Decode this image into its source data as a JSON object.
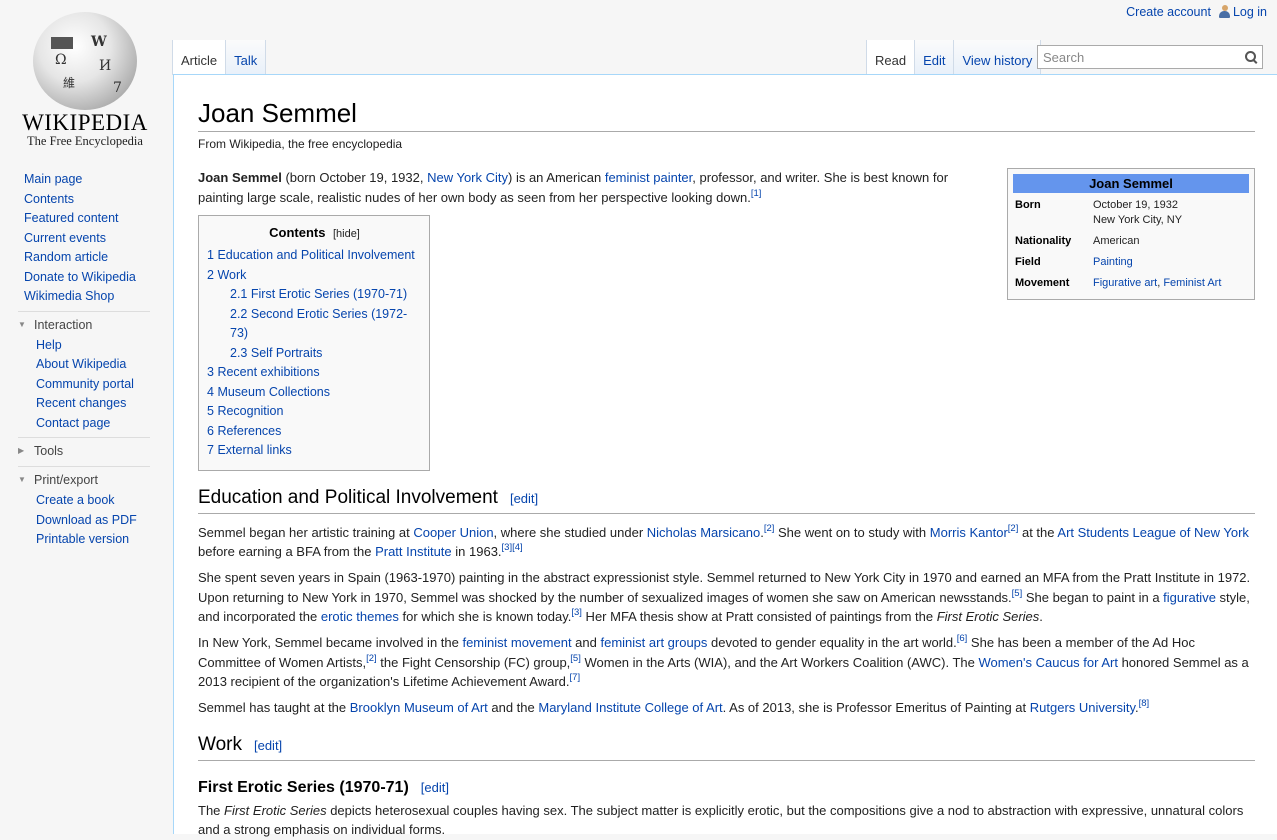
{
  "logo": {
    "wordmark": "Wikipedia",
    "tagline": "The Free Encyclopedia"
  },
  "personal": {
    "create_account": "Create account",
    "log_in": "Log in"
  },
  "tabs": {
    "left": [
      {
        "label": "Article",
        "selected": true
      },
      {
        "label": "Talk",
        "selected": false
      }
    ],
    "right": [
      {
        "label": "Read",
        "selected": true
      },
      {
        "label": "Edit",
        "selected": false
      },
      {
        "label": "View history",
        "selected": false
      }
    ]
  },
  "search": {
    "placeholder": "Search",
    "value": ""
  },
  "sidebar": {
    "navigation": [
      "Main page",
      "Contents",
      "Featured content",
      "Current events",
      "Random article",
      "Donate to Wikipedia",
      "Wikimedia Shop"
    ],
    "interaction": {
      "title": "Interaction",
      "items": [
        "Help",
        "About Wikipedia",
        "Community portal",
        "Recent changes",
        "Contact page"
      ]
    },
    "tools": {
      "title": "Tools"
    },
    "print": {
      "title": "Print/export",
      "items": [
        "Create a book",
        "Download as PDF",
        "Printable version"
      ]
    }
  },
  "article": {
    "title": "Joan Semmel",
    "subtitle": "From Wikipedia, the free encyclopedia",
    "intro": {
      "name": "Joan Semmel",
      "t1": " (born October 19, 1932, ",
      "l1": "New York City",
      "t2": ") is an American ",
      "l2": "feminist painter",
      "t3": ", professor, and writer. She is best known for painting large scale, realistic nudes of her own body as seen from her perspective looking down.",
      "ref1": "[1]"
    },
    "infobox": {
      "title": "Joan Semmel",
      "born_label": "Born",
      "born_date": "October 19, 1932",
      "born_place": "New York City, NY",
      "nationality_label": "Nationality",
      "nationality": "American",
      "field_label": "Field",
      "field": "Painting",
      "movement_label": "Movement",
      "movement_1": "Figurative art",
      "movement_sep": ", ",
      "movement_2": "Feminist Art"
    },
    "toc": {
      "title": "Contents",
      "toggle": "[hide]",
      "items": [
        {
          "num": "1",
          "label": "Education and Political Involvement"
        },
        {
          "num": "2",
          "label": "Work"
        },
        {
          "num": "2.1",
          "label": "First Erotic Series (1970-71)"
        },
        {
          "num": "2.2",
          "label": "Second Erotic Series (1972-73)"
        },
        {
          "num": "2.3",
          "label": "Self Portraits"
        },
        {
          "num": "3",
          "label": "Recent exhibitions"
        },
        {
          "num": "4",
          "label": "Museum Collections"
        },
        {
          "num": "5",
          "label": "Recognition"
        },
        {
          "num": "6",
          "label": "References"
        },
        {
          "num": "7",
          "label": "External links"
        }
      ]
    },
    "edit_label": "[edit]",
    "education": {
      "heading": "Education and Political Involvement",
      "p1": {
        "t1": "Semmel began her artistic training at ",
        "l1": "Cooper Union",
        "t2": ", where she studied under ",
        "l2": "Nicholas Marsicano",
        "t3": ".",
        "r1": "[2]",
        "t4": " She went on to study with ",
        "l3": "Morris Kantor",
        "r2": "[2]",
        "t5": " at the ",
        "l4": "Art Students League of New York",
        "t6": " before earning a BFA from the ",
        "l5": "Pratt Institute",
        "t7": " in 1963.",
        "r3": "[3][4]"
      },
      "p2": {
        "t1": "She spent seven years in Spain (1963-1970) painting in the abstract expressionist style. Semmel returned to New York City in 1970 and earned an MFA from the Pratt Institute in 1972. Upon returning to New York in 1970, Semmel was shocked by the number of sexualized images of women she saw on American newsstands.",
        "r1": "[5]",
        "t2": " She began to paint in a ",
        "l1": "figurative",
        "t3": " style, and incorporated the ",
        "l2": "erotic themes",
        "t4": " for which she is known today.",
        "r2": "[3]",
        "t5": " Her MFA thesis show at Pratt consisted of paintings from the ",
        "i1": "First Erotic Series",
        "t6": "."
      },
      "p3": {
        "t1": "In New York, Semmel became involved in the ",
        "l1": "feminist movement",
        "t2": " and ",
        "l2": "feminist art groups",
        "t3": " devoted to gender equality in the art world.",
        "r1": "[6]",
        "t4": " She has been a member of the Ad Hoc Committee of Women Artists,",
        "r2": "[2]",
        "t5": " the Fight Censorship (FC) group,",
        "r3": "[5]",
        "t6": " Women in the Arts (WIA), and the Art Workers Coalition (AWC). The ",
        "l3": "Women's Caucus for Art",
        "t7": " honored Semmel as a 2013 recipient of the organization's Lifetime Achievement Award.",
        "r4": "[7]"
      },
      "p4": {
        "t1": "Semmel has taught at the ",
        "l1": "Brooklyn Museum of Art",
        "t2": " and the ",
        "l2": "Maryland Institute College of Art",
        "t3": ". As of 2013, she is Professor Emeritus of Painting at ",
        "l3": "Rutgers University",
        "t4": ".",
        "r1": "[8]"
      }
    },
    "work": {
      "heading": "Work",
      "sub1_heading": "First Erotic Series (1970-71)",
      "p1": {
        "t1": "The ",
        "i1": "First Erotic Series",
        "t2": " depicts heterosexual couples having sex. The subject matter is explicitly erotic, but the compositions give a nod to abstraction with expressive, unnatural colors and a strong emphasis on individual forms."
      }
    }
  }
}
